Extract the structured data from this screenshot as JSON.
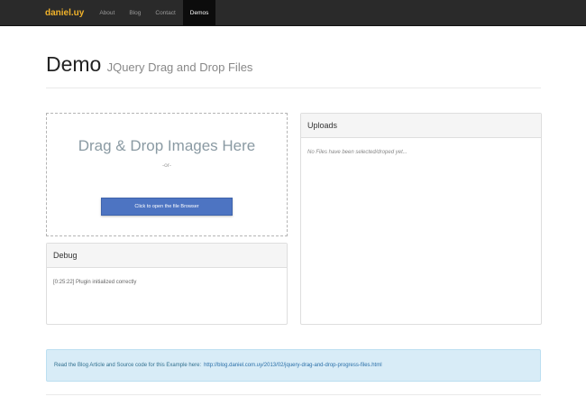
{
  "navbar": {
    "brand": "daniel.uy",
    "items": [
      {
        "label": "About",
        "active": false
      },
      {
        "label": "Blog",
        "active": false
      },
      {
        "label": "Contact",
        "active": false
      },
      {
        "label": "Demos",
        "active": true
      }
    ]
  },
  "header": {
    "title": "Demo",
    "subtitle": "JQuery Drag and Drop Files"
  },
  "dropzone": {
    "title": "Drag & Drop Images Here",
    "or_text": "-or-",
    "button_label": "Click to open the file Browser"
  },
  "debug": {
    "title": "Debug",
    "log": "[0:25:22] Plugin initialized correctly"
  },
  "uploads": {
    "title": "Uploads",
    "empty_text": "No Files have been selected/droped yet..."
  },
  "info": {
    "text": "Read the Blog Article and Source code for this Example here:",
    "link": "http://blog.daniel.com.uy/2013/02/jquery-drag-and-drop-progress-files.html"
  },
  "colors": {
    "brand": "#f0b22a",
    "button": "#4d74c2",
    "info_bg": "#d8ecf7",
    "navbar_bg": "#2a2a2a"
  }
}
